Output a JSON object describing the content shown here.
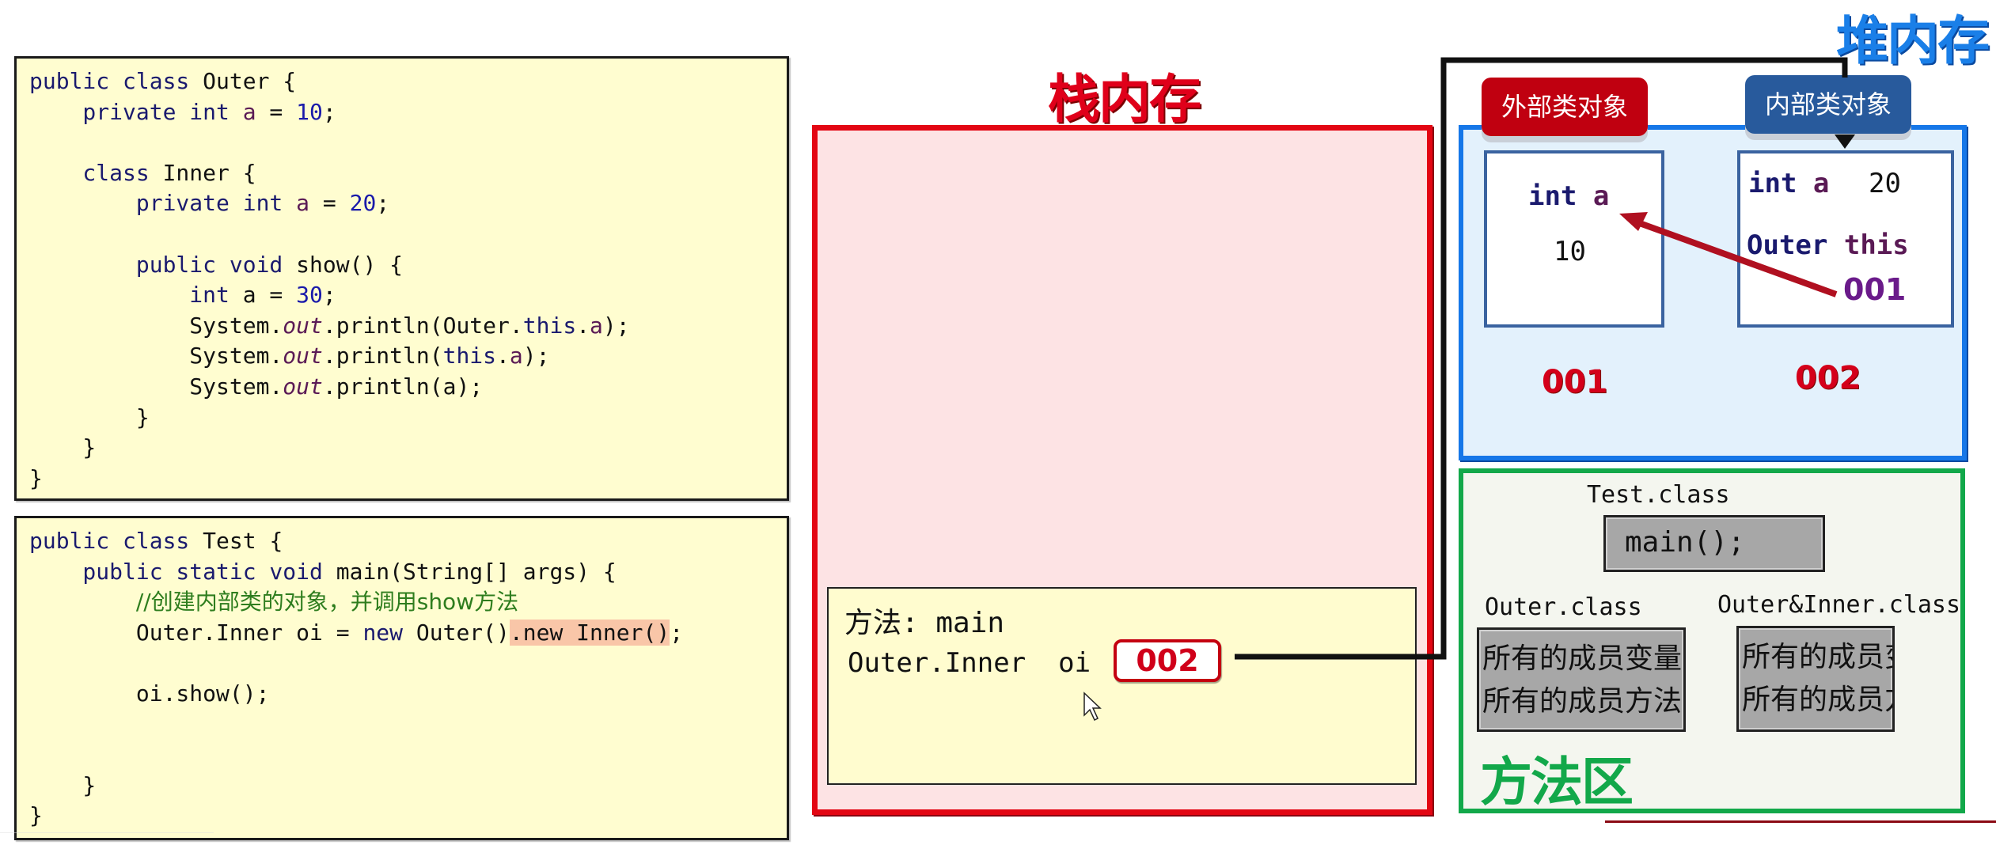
{
  "code_panels": {
    "outer_class": [
      [
        {
          "t": "public class ",
          "c": "kw"
        },
        {
          "t": "Outer {",
          "c": ""
        }
      ],
      [
        {
          "t": "    private int ",
          "c": "kw"
        },
        {
          "t": "a",
          "c": "fld"
        },
        {
          "t": " = ",
          "c": ""
        },
        {
          "t": "10",
          "c": "num"
        },
        {
          "t": ";",
          "c": ""
        }
      ],
      [],
      [
        {
          "t": "    class ",
          "c": "kw"
        },
        {
          "t": "Inner {",
          "c": ""
        }
      ],
      [
        {
          "t": "        private int ",
          "c": "kw"
        },
        {
          "t": "a",
          "c": "fld"
        },
        {
          "t": " = ",
          "c": ""
        },
        {
          "t": "20",
          "c": "num"
        },
        {
          "t": ";",
          "c": ""
        }
      ],
      [],
      [
        {
          "t": "        public void ",
          "c": "kw"
        },
        {
          "t": "show() {",
          "c": ""
        }
      ],
      [
        {
          "t": "            int ",
          "c": "kw"
        },
        {
          "t": "a = ",
          "c": ""
        },
        {
          "t": "30",
          "c": "num"
        },
        {
          "t": ";",
          "c": ""
        }
      ],
      [
        {
          "t": "            System.",
          "c": ""
        },
        {
          "t": "out",
          "c": "ital"
        },
        {
          "t": ".println(Outer.",
          "c": ""
        },
        {
          "t": "this",
          "c": "kw"
        },
        {
          "t": ".",
          "c": ""
        },
        {
          "t": "a",
          "c": "fld"
        },
        {
          "t": ");",
          "c": ""
        }
      ],
      [
        {
          "t": "            System.",
          "c": ""
        },
        {
          "t": "out",
          "c": "ital"
        },
        {
          "t": ".println(",
          "c": ""
        },
        {
          "t": "this",
          "c": "kw"
        },
        {
          "t": ".",
          "c": ""
        },
        {
          "t": "a",
          "c": "fld"
        },
        {
          "t": ");",
          "c": ""
        }
      ],
      [
        {
          "t": "            System.",
          "c": ""
        },
        {
          "t": "out",
          "c": "ital"
        },
        {
          "t": ".println(a);",
          "c": ""
        }
      ],
      [
        {
          "t": "        }",
          "c": ""
        }
      ],
      [
        {
          "t": "    }",
          "c": ""
        }
      ],
      [
        {
          "t": "}",
          "c": ""
        }
      ]
    ],
    "test_class": [
      [
        {
          "t": "public class ",
          "c": "kw"
        },
        {
          "t": "Test {",
          "c": ""
        }
      ],
      [
        {
          "t": "    public static void ",
          "c": "kw"
        },
        {
          "t": "main(String[] args) {",
          "c": ""
        }
      ],
      [
        {
          "t": "        ",
          "c": ""
        },
        {
          "t": "//创建内部类的对象，并调用show方法",
          "c": "cmt"
        }
      ],
      [
        {
          "t": "        Outer.Inner oi = ",
          "c": ""
        },
        {
          "t": "new ",
          "c": "kw"
        },
        {
          "t": "Outer()",
          "c": ""
        },
        {
          "t": ".new Inner()",
          "c": "hl"
        },
        {
          "t": ";",
          "c": ""
        }
      ],
      [],
      [
        {
          "t": "        oi.show();",
          "c": ""
        }
      ],
      [],
      [],
      [
        {
          "t": "    }",
          "c": ""
        }
      ],
      [
        {
          "t": "}",
          "c": ""
        }
      ]
    ]
  },
  "stack": {
    "title": "栈内存",
    "frame": {
      "method_label": "方法: main",
      "var_decl": "Outer.Inner  oi",
      "var_ref": "002"
    }
  },
  "heap": {
    "title": "堆内存",
    "outer_object": {
      "label": "外部类对象",
      "field": "int",
      "field_name": "a",
      "value": "10",
      "address": "001"
    },
    "inner_object": {
      "label": "内部类对象",
      "field": "int",
      "field_name": "a",
      "value": "20",
      "outer_ref_type": "Outer",
      "outer_ref_name": "this",
      "outer_ref_value": "001",
      "address": "002"
    }
  },
  "method_area": {
    "title": "方法区",
    "test_class": {
      "name": "Test.class",
      "content": "main();"
    },
    "outer_class": {
      "name": "Outer.class",
      "lines": [
        "所有的成员变量",
        "所有的成员方法"
      ]
    },
    "inner_class": {
      "name": "Outer&Inner.class",
      "lines": [
        "所有的成员变量",
        "所有的成员方法"
      ]
    }
  },
  "colors": {
    "stack_accent": "#e30613",
    "heap_accent": "#1677e8",
    "method_area_accent": "#12a84a",
    "pointer_arrow": "#b01020"
  }
}
